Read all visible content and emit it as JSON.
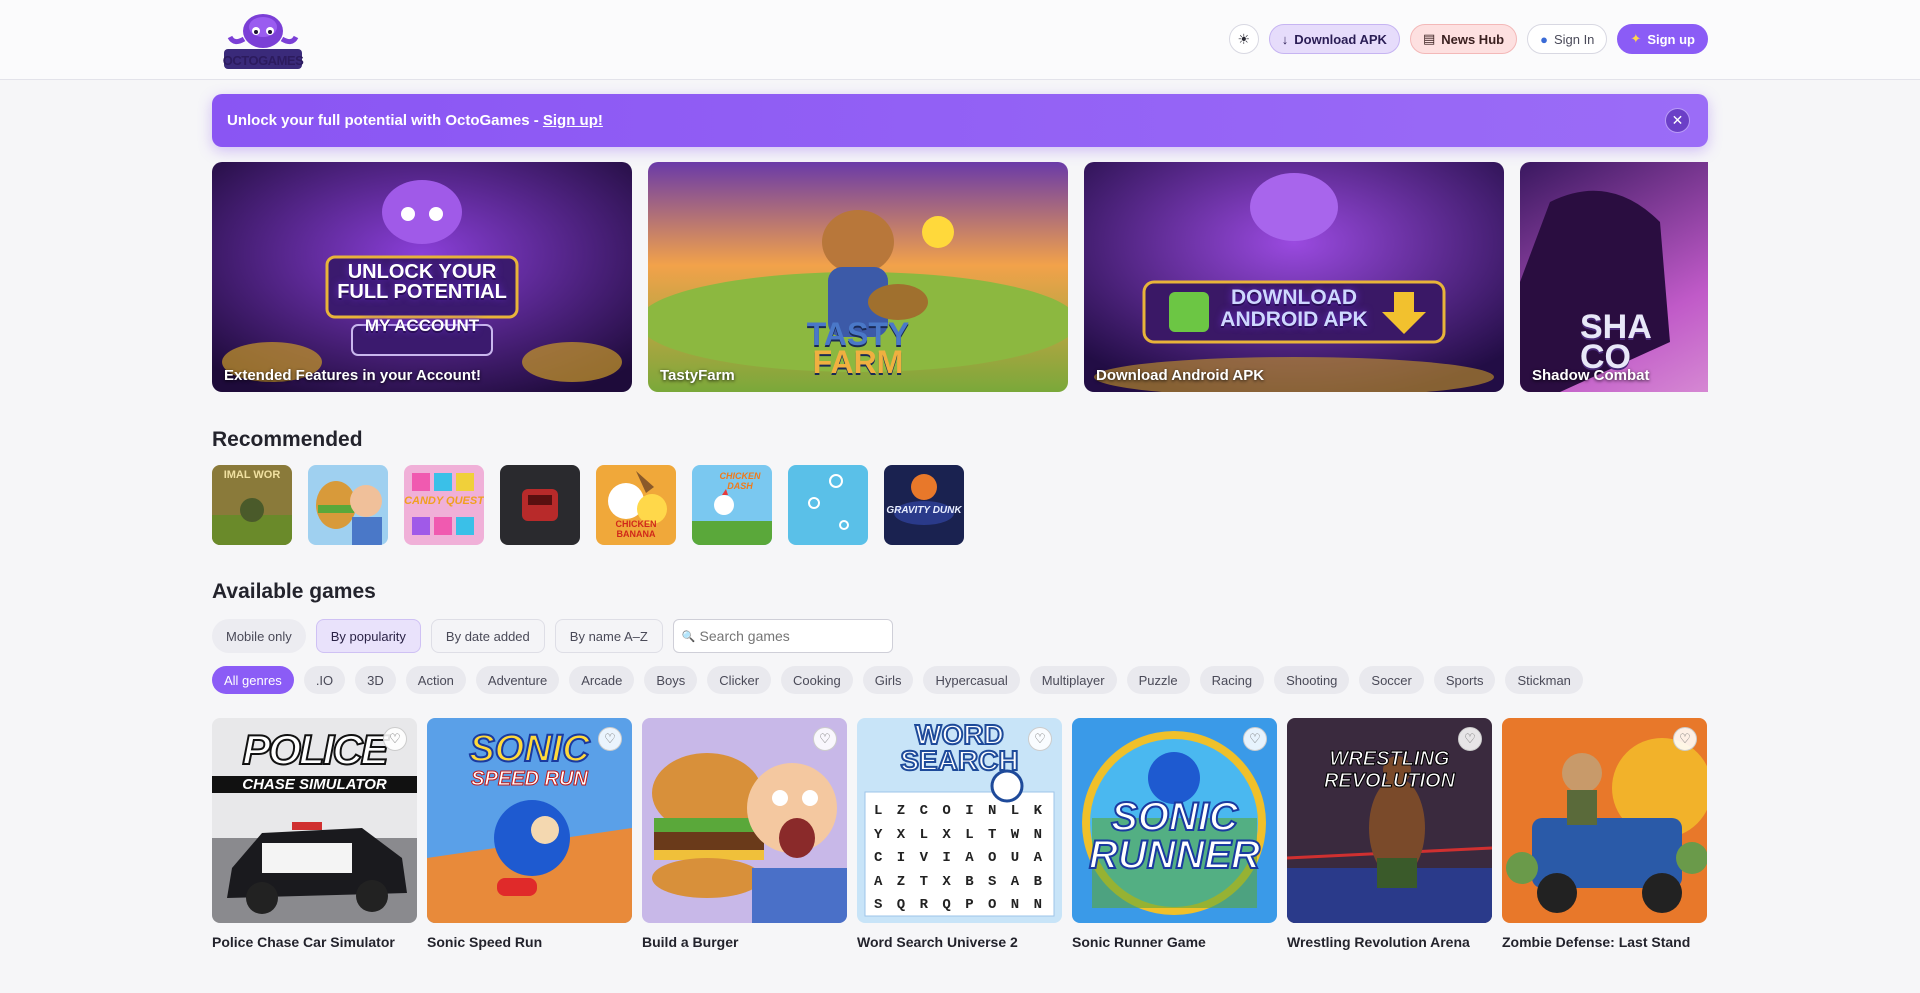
{
  "header": {
    "logo_text": "OCTOGAMES",
    "theme_icon": "sun-icon",
    "theme_glyph": "☀",
    "download_apk": "Download APK",
    "news_hub": "News Hub",
    "sign_in": "Sign In",
    "sign_up": "Sign up"
  },
  "banner": {
    "text": "Unlock your full potential with OctoGames - ",
    "link": "Sign up!",
    "close_glyph": "✕"
  },
  "hero": [
    {
      "title": "Extended Features in your Account!",
      "art_text_1": "UNLOCK YOUR",
      "art_text_2": "FULL POTENTIAL",
      "art_text_3": "MY ACCOUNT"
    },
    {
      "title": "TastyFarm",
      "art_text_1": "TASTY",
      "art_text_2": "FARM"
    },
    {
      "title": "Download Android APK",
      "art_text_1": "DOWNLOAD",
      "art_text_2": "ANDROID APK"
    },
    {
      "title": "Shadow Combat",
      "art_text_1": "SHA",
      "art_text_2": "CO"
    }
  ],
  "recommended": {
    "title": "Recommended",
    "tiles": [
      "IMAL WOR",
      "",
      "CANDY QUEST",
      "",
      "CHICKEN BANANA",
      "CHICKEN DASH",
      "",
      "GRAVITY DUNK"
    ]
  },
  "available": {
    "title": "Available games",
    "mobile_only": "Mobile only",
    "by_popularity": "By popularity",
    "by_date": "By date added",
    "by_name": "By name A–Z",
    "search_placeholder": "Search games",
    "search_glyph": "🔍"
  },
  "genres": [
    "All genres",
    ".IO",
    "3D",
    "Action",
    "Adventure",
    "Arcade",
    "Boys",
    "Clicker",
    "Cooking",
    "Girls",
    "Hypercasual",
    "Multiplayer",
    "Puzzle",
    "Racing",
    "Shooting",
    "Soccer",
    "Sports",
    "Stickman"
  ],
  "games": [
    {
      "title": "Police Chase Car Simulator",
      "art": "POLICE",
      "art2": "CHASE SIMULATOR"
    },
    {
      "title": "Sonic Speed Run",
      "art": "SONIC",
      "art2": "SPEED RUN"
    },
    {
      "title": "Build a Burger",
      "art": "",
      "art2": ""
    },
    {
      "title": "Word Search Universe 2",
      "art": "WORD",
      "art2": "SEARCH"
    },
    {
      "title": "Sonic Runner Game",
      "art": "SONIC",
      "art2": "RUNNER"
    },
    {
      "title": "Wrestling Revolution Arena",
      "art": "WRESTLING",
      "art2": "REVOLUTION"
    },
    {
      "title": "Zombie Defense: Last Stand",
      "art": "",
      "art2": ""
    }
  ],
  "word_grid": [
    "L Z C O I N L K",
    "Y X L X L T W N",
    "C I V I A O U A",
    "A Z T X B S A B",
    "S Q R Q P O N N"
  ],
  "fav_glyph": "♡"
}
